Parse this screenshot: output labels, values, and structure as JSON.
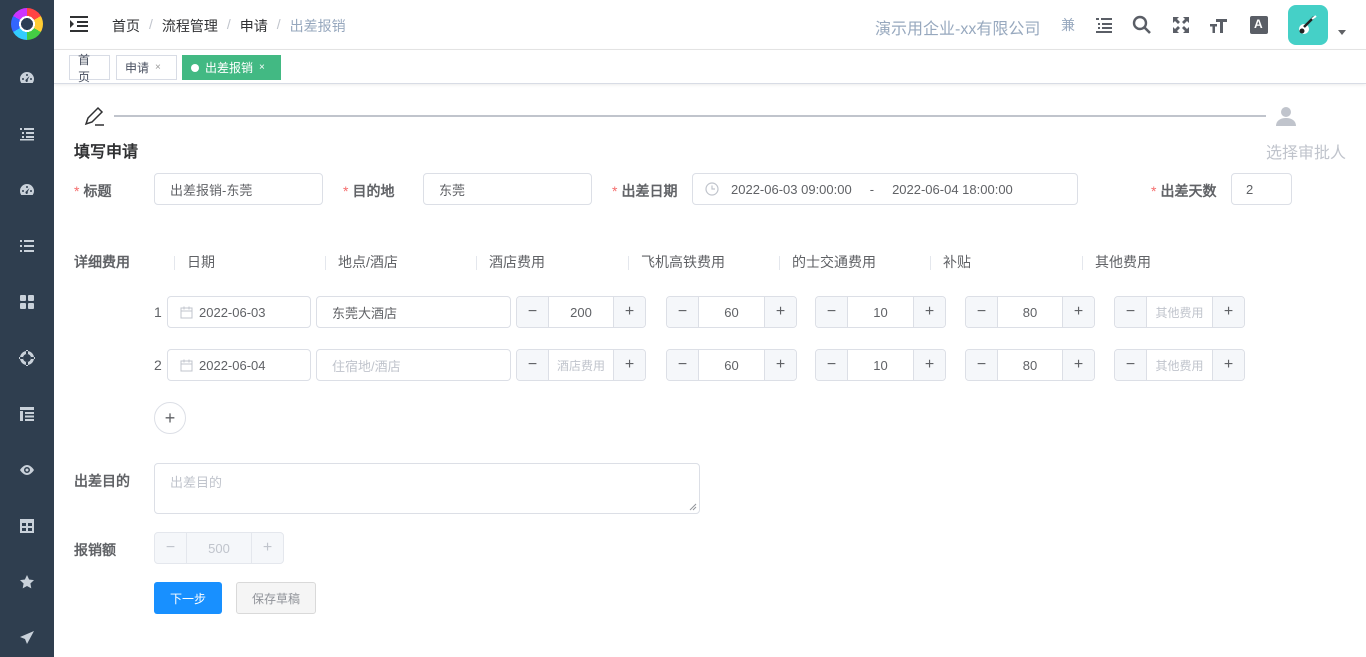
{
  "sidebar": {
    "items": [
      {
        "icon": "dashboard-icon"
      },
      {
        "icon": "list-icon"
      },
      {
        "icon": "gauge-icon"
      },
      {
        "icon": "menu-list-icon"
      },
      {
        "icon": "grid-icon"
      },
      {
        "icon": "target-icon"
      },
      {
        "icon": "tree-table-icon"
      },
      {
        "icon": "eye-icon"
      },
      {
        "icon": "table-icon"
      },
      {
        "icon": "star-icon"
      },
      {
        "icon": "send-icon"
      }
    ]
  },
  "header": {
    "breadcrumb": [
      "首页",
      "流程管理",
      "申请",
      "出差报销"
    ],
    "breadcrumb_sep": "/",
    "company": "演示用企业-xx有限公司",
    "tool_text": "兼",
    "tools": [
      "list-icon",
      "search-icon",
      "fullscreen-icon",
      "font-size-icon",
      "translate-icon"
    ],
    "translate_glyph": "A"
  },
  "tags": [
    {
      "label": "首页",
      "closable": false,
      "active": false
    },
    {
      "label": "申请",
      "closable": true,
      "active": false
    },
    {
      "label": "出差报销",
      "closable": true,
      "active": true
    }
  ],
  "tag_close": "×",
  "steps": {
    "step1": "填写申请",
    "step2": "选择审批人"
  },
  "form": {
    "title_label": "标题",
    "title_value": "出差报销-东莞",
    "dest_label": "目的地",
    "dest_value": "东莞",
    "date_label": "出差日期",
    "date_start": "2022-06-03 09:00:00",
    "date_sep": "-",
    "date_end": "2022-06-04 18:00:00",
    "days_label": "出差天数",
    "days_value": "2",
    "required_mark": "*",
    "detail_label": "详细费用",
    "columns": [
      "日期",
      "地点/酒店",
      "酒店费用",
      "飞机高铁费用",
      "的士交通费用",
      "补贴",
      "其他费用"
    ],
    "rows": [
      {
        "no": "1",
        "date": "2022-06-03",
        "place": "东莞大酒店",
        "place_ph": false,
        "hotel": "200",
        "hotel_ph": false,
        "flight": "60",
        "taxi": "10",
        "allowance": "80",
        "other": "其他费用"
      },
      {
        "no": "2",
        "date": "2022-06-04",
        "place": "住宿地/酒店",
        "place_ph": true,
        "hotel": "酒店费用",
        "hotel_ph": true,
        "flight": "60",
        "taxi": "10",
        "allowance": "80",
        "other": "其他费用"
      }
    ],
    "minus": "−",
    "plus": "+",
    "add_row": "+",
    "purpose_label": "出差目的",
    "purpose_placeholder": "出差目的",
    "amount_label": "报销额",
    "amount_value": "500",
    "next_button": "下一步",
    "draft_button": "保存草稿"
  },
  "colors": {
    "sidebar_bg": "#2f3e4f",
    "active_tag": "#42b983",
    "primary": "#1890ff",
    "required": "#f56c6c",
    "avatar": "#45d0c7"
  }
}
